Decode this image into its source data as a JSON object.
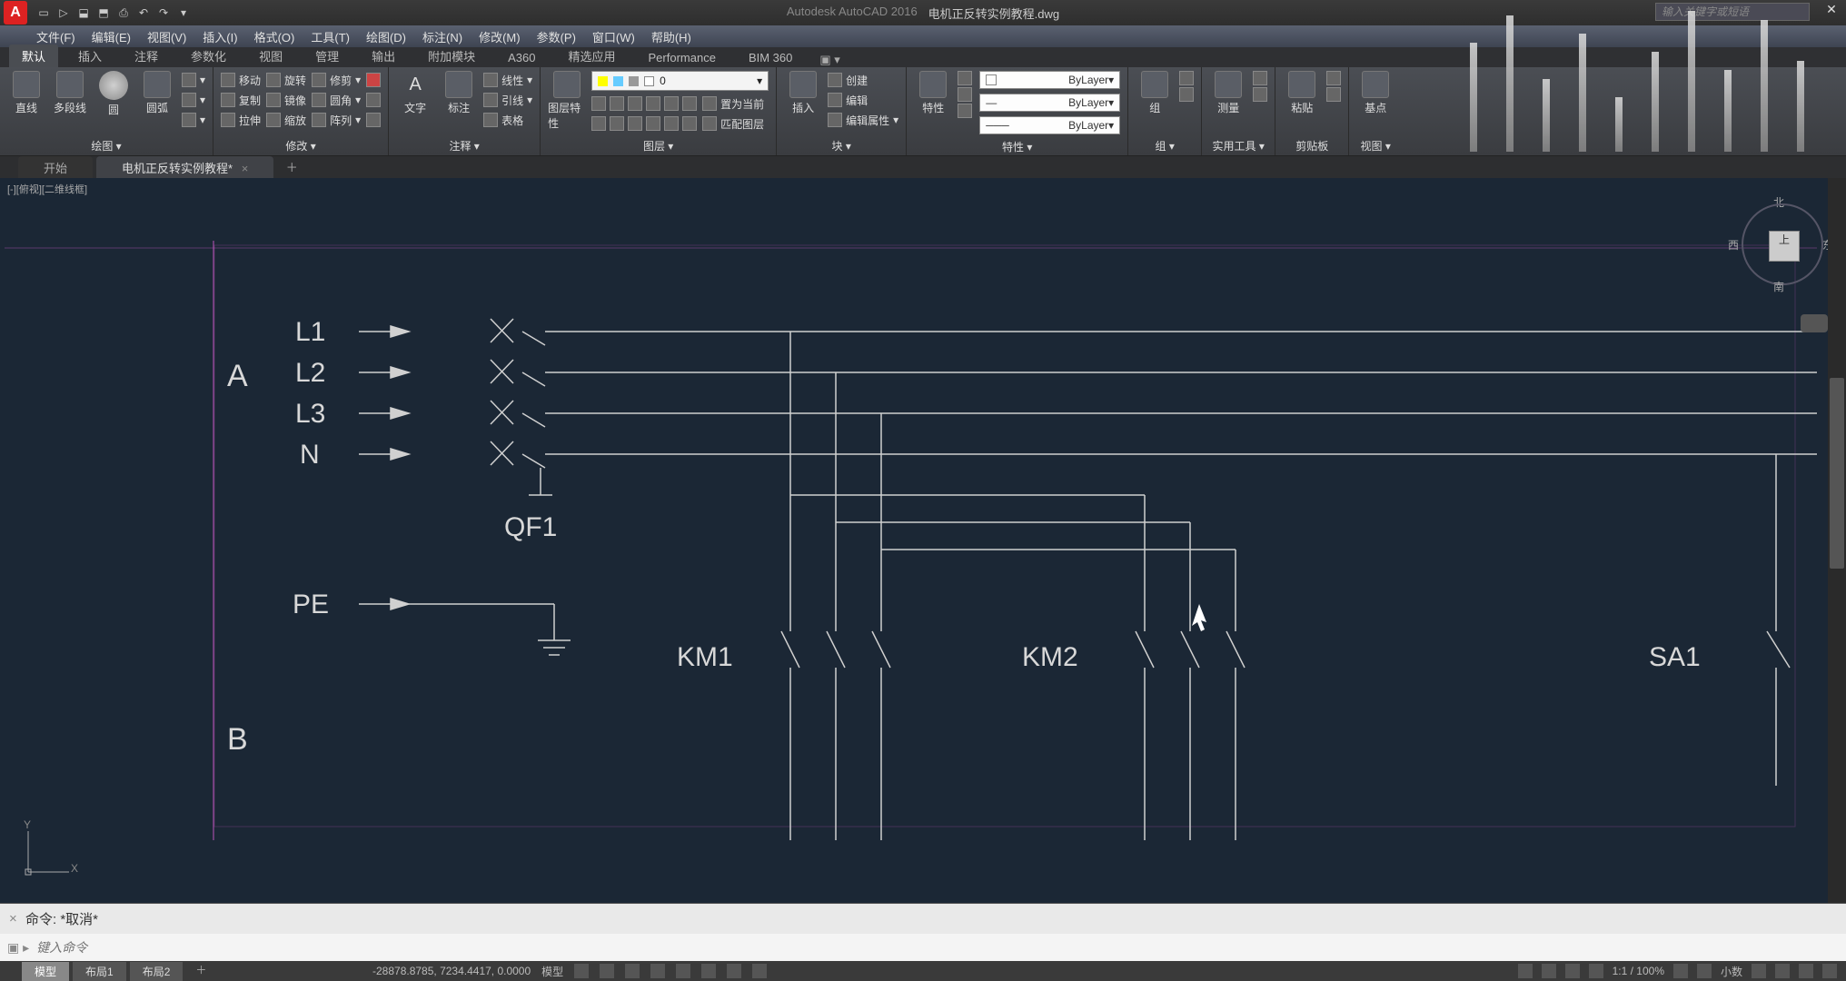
{
  "title": {
    "app": "Autodesk AutoCAD 2016",
    "doc": "电机正反转实例教程.dwg"
  },
  "search": {
    "placeholder": "输入关键字或短语"
  },
  "qat_tips": [
    "新建",
    "打开",
    "保存",
    "另存",
    "打印",
    "撤销",
    "重做"
  ],
  "menu": [
    "文件(F)",
    "编辑(E)",
    "视图(V)",
    "插入(I)",
    "格式(O)",
    "工具(T)",
    "绘图(D)",
    "标注(N)",
    "修改(M)",
    "参数(P)",
    "窗口(W)",
    "帮助(H)"
  ],
  "ribbon_tabs": [
    "默认",
    "插入",
    "注释",
    "参数化",
    "视图",
    "管理",
    "输出",
    "附加模块",
    "A360",
    "精选应用",
    "Performance",
    "BIM 360"
  ],
  "panels": {
    "draw": {
      "title": "绘图 ▾",
      "btns": [
        "直线",
        "多段线",
        "圆",
        "圆弧"
      ]
    },
    "modify": {
      "title": "修改 ▾",
      "rows": [
        [
          "移动",
          "旋转",
          "修剪"
        ],
        [
          "复制",
          "镜像",
          "圆角"
        ],
        [
          "拉伸",
          "缩放",
          "阵列"
        ]
      ]
    },
    "annot": {
      "title": "注释 ▾",
      "big": [
        "文字",
        "标注"
      ],
      "rows": [
        "线性",
        "引线",
        "表格"
      ]
    },
    "layer": {
      "title": "图层 ▾",
      "big": "图层特性",
      "dd": "0",
      "rows": [
        "置为当前",
        "匹配图层"
      ],
      "row_icons": 6
    },
    "block": {
      "title": "块 ▾",
      "big": "插入",
      "rows": [
        "创建",
        "编辑",
        "编辑属性"
      ]
    },
    "props": {
      "title": "特性 ▾",
      "big": "特性",
      "dd": [
        "ByLayer",
        "ByLayer",
        "ByLayer"
      ]
    },
    "group": {
      "title": "组 ▾",
      "big": "组"
    },
    "util": {
      "title": "实用工具 ▾",
      "big": "测量"
    },
    "clip": {
      "title": "剪贴板",
      "big": "粘贴"
    },
    "view": {
      "title": "视图 ▾",
      "big": "基点"
    }
  },
  "doc_tabs": {
    "inactive": "开始",
    "active": "电机正反转实例教程*"
  },
  "viewport_label": "[-][俯视][二维线框]",
  "viewcube": {
    "n": "北",
    "s": "南",
    "e": "东",
    "w": "西",
    "top": "上"
  },
  "drawing_labels": {
    "A": "A",
    "B": "B",
    "L1": "L1",
    "L2": "L2",
    "L3": "L3",
    "N": "N",
    "PE": "PE",
    "QF1": "QF1",
    "KM1": "KM1",
    "KM2": "KM2",
    "SA1": "SA1"
  },
  "ucs": {
    "x": "X",
    "y": "Y"
  },
  "cmd": {
    "history": "命令:  *取消*",
    "placeholder": "键入命令"
  },
  "layout_tabs": [
    "模型",
    "布局1",
    "布局2"
  ],
  "status": {
    "coords": "-28878.8785, 7234.4417, 0.0000",
    "space": "模型",
    "scale": "1:1 / 100%",
    "anno": "小数"
  }
}
